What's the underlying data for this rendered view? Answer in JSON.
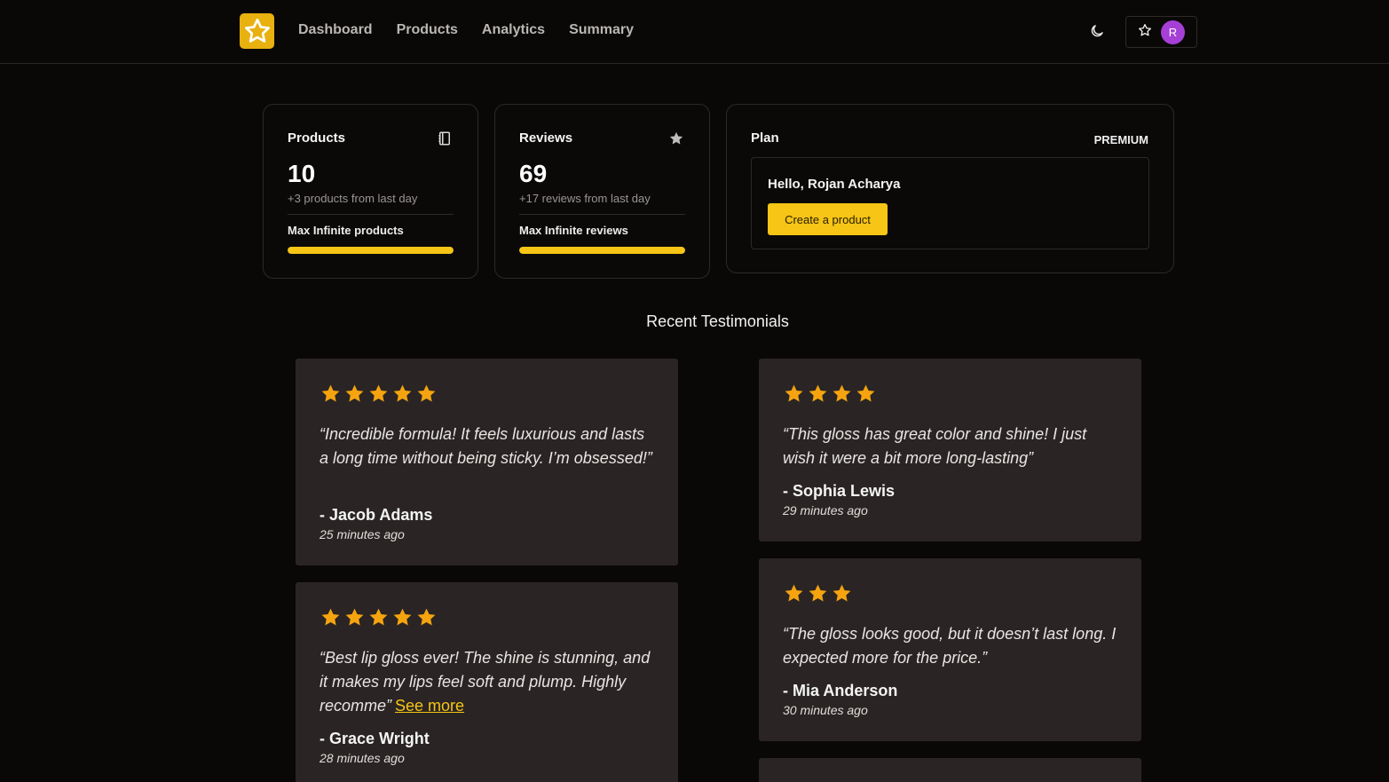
{
  "nav": {
    "links": [
      "Dashboard",
      "Products",
      "Analytics",
      "Summary"
    ],
    "avatar_initial": "R"
  },
  "stats": {
    "products": {
      "title": "Products",
      "value": "10",
      "sub": "+3 products from last day",
      "max": "Max Infinite products",
      "progress": 1.0
    },
    "reviews": {
      "title": "Reviews",
      "value": "69",
      "sub": "+17 reviews from last day",
      "max": "Max Infinite reviews",
      "progress": 1.0
    },
    "plan": {
      "title": "Plan",
      "tier": "PREMIUM",
      "greeting": "Hello, Rojan Acharya",
      "button": "Create a product"
    }
  },
  "testimonials": {
    "heading": "Recent Testimonials",
    "items": [
      {
        "stars": 5,
        "quote": "“Incredible formula! It feels luxurious and lasts a long time without being sticky. I’m obsessed!”",
        "author": "- Jacob Adams",
        "time": "25 minutes ago"
      },
      {
        "stars": 4,
        "quote": "“This gloss has great color and shine! I just wish it were a bit more long-lasting”",
        "author": "- Sophia Lewis",
        "time": "29 minutes ago"
      },
      {
        "stars": 5,
        "quote": "“Best lip gloss ever! The shine is stunning, and it makes my lips feel soft and plump. Highly recomme”",
        "see_more": "See more",
        "author": "- Grace Wright",
        "time": "28 minutes ago"
      },
      {
        "stars": 3,
        "quote": "“The gloss looks good, but it doesn’t last long. I expected more for the price.”",
        "author": "- Mia Anderson",
        "time": "30 minutes ago"
      }
    ]
  },
  "colors": {
    "accent": "#f6c515",
    "star": "#f5a40f",
    "background": "#0a0807",
    "card": "#2a2524"
  }
}
